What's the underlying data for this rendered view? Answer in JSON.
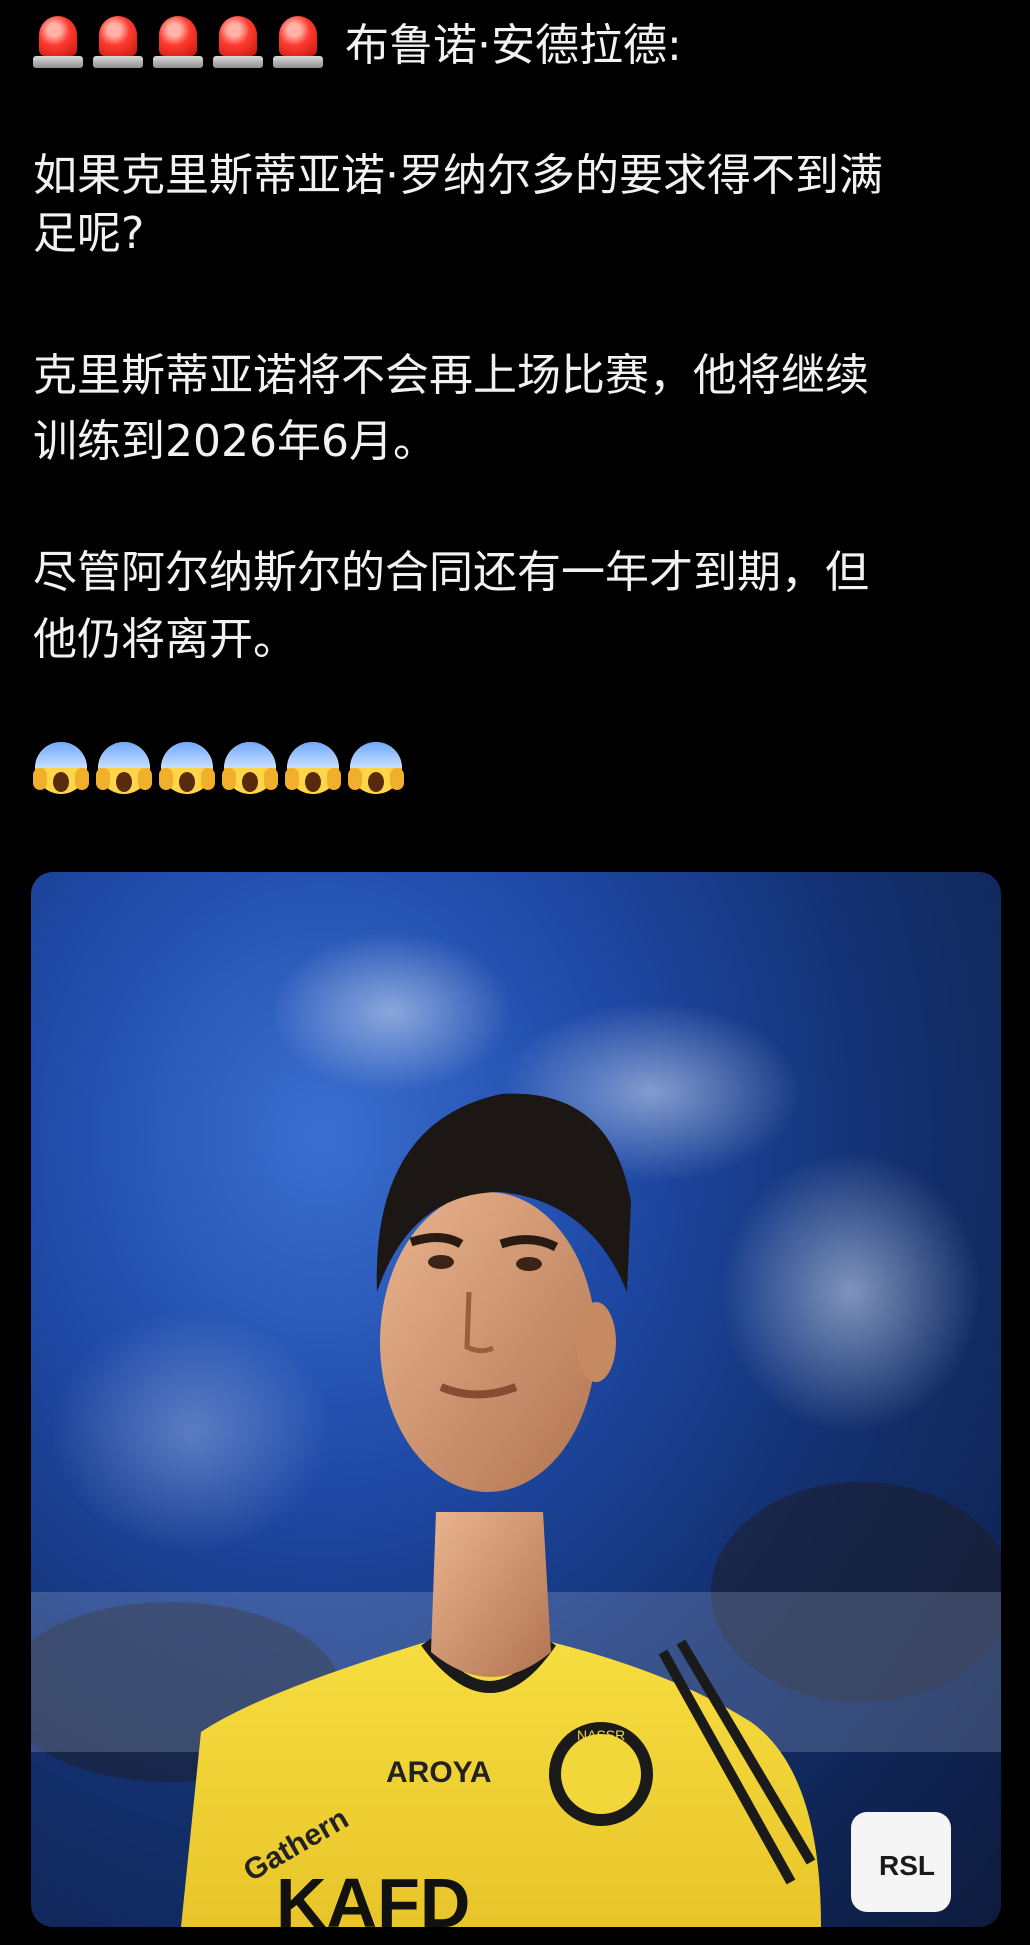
{
  "post": {
    "header": {
      "author": "布鲁诺·安德拉德:",
      "siren_count": 5
    },
    "paragraphs": [
      [
        "如果克里斯蒂亚诺·罗纳尔多的要求得不到满",
        "足呢?"
      ],
      [
        "克里斯蒂亚诺将不会再上场比赛，他将继续",
        "训练到2026年6月。"
      ],
      [
        "尽管阿尔纳斯尔的合同还有一年才到期，但",
        "他仍将离开。"
      ]
    ],
    "scream_count": 6,
    "photo": {
      "icon_names": [
        "siren-emoji-icon",
        "screaming-face-emoji-icon"
      ],
      "jersey_texts": {
        "sponsor": "Gathern",
        "brand": "AROYA",
        "front": "KAFD",
        "badge": "NASSR",
        "patch": "RSL"
      },
      "colors": {
        "jersey": "#f2d73a",
        "sky": "#2b5fc7",
        "background": "#000000"
      }
    }
  }
}
